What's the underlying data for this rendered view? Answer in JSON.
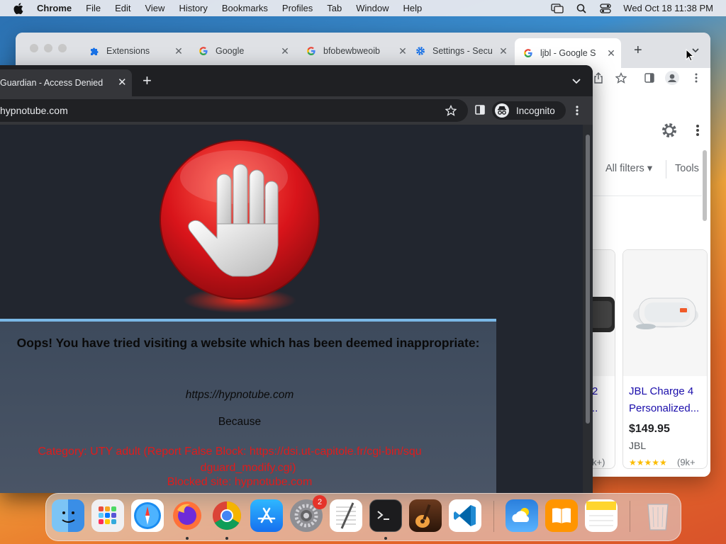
{
  "menubar": {
    "app_name": "Chrome",
    "items": [
      "File",
      "Edit",
      "View",
      "History",
      "Bookmarks",
      "Profiles",
      "Tab",
      "Window",
      "Help"
    ],
    "clock": "Wed Oct 18  11:38 PM",
    "icons": [
      "screen-mirroring-icon",
      "spotlight-search-icon",
      "control-center-icon"
    ]
  },
  "back_window": {
    "tabs": [
      {
        "label": "Extensions",
        "icon": "puzzle-icon"
      },
      {
        "label": "Google",
        "icon": "google-g-icon"
      },
      {
        "label": "bfobewbweoib",
        "icon": "google-g-icon"
      },
      {
        "label": "Settings - Secu",
        "icon": "gear-icon"
      },
      {
        "label": "ljbl - Google S",
        "icon": "google-g-icon"
      }
    ],
    "filters": {
      "all_filters": "All filters ▾",
      "tools": "Tools"
    },
    "products": [
      {
        "name_line1": "2",
        "name_line2": "..",
        "reviews": "k+)"
      },
      {
        "name_line1": "JBL Charge 4",
        "name_line2": "Personalized...",
        "price": "$149.95",
        "brand": "JBL",
        "stars": "★★★★★",
        "reviews": "(9k+"
      }
    ]
  },
  "front_window": {
    "tab_title": "Guardian - Access Denied",
    "url": "hypnotube.com",
    "incognito_label": "Incognito",
    "message": {
      "heading": "Oops! You have tried visiting a website which has been deemed inappropriate:",
      "blocked_url": "https://hypnotube.com",
      "because": "Because",
      "category_line1": "Category: UTY adult (Report False Block: https://dsi.ut-capitole.fr/cgi-bin/squ",
      "category_line2": "dguard_modify.cgi)",
      "blocked_site": "Blocked site: hypnotube.com"
    }
  },
  "dock": {
    "apps": [
      "Finder",
      "Launchpad",
      "Safari",
      "Firefox",
      "Chrome",
      "App Store",
      "System Settings",
      "TextEdit",
      "Terminal",
      "GarageBand",
      "VS Code",
      "Weather",
      "Books",
      "Notes",
      "Trash"
    ],
    "settings_badge": "2"
  }
}
